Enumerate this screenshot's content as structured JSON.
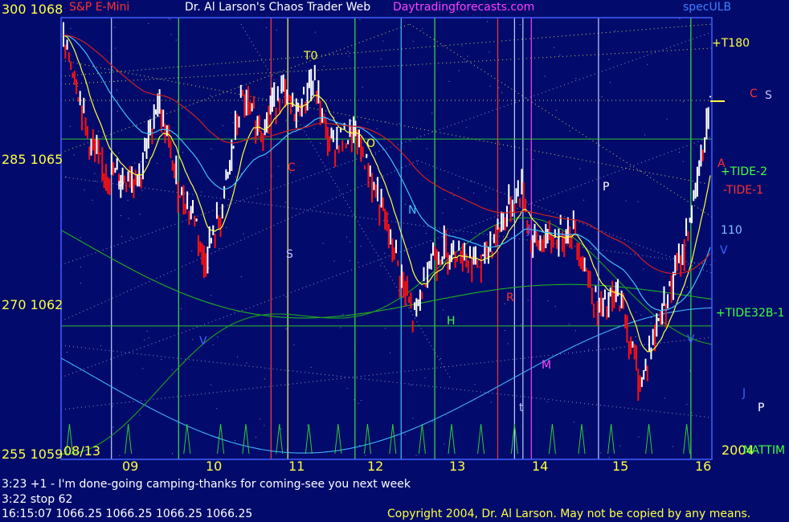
{
  "header": {
    "instrument": "S&P E-Mini",
    "title": "Dr. Al Larson's Chaos Trader Web",
    "site": "Daytradingforecasts.com",
    "spec": "specULB"
  },
  "colors": {
    "background": "#020b6b",
    "price_up": "#ffffff",
    "price_down": "#ff1010",
    "axis_label": "#ffff40",
    "ema_fast": "#ffff40",
    "ema_mid": "#40c0ff",
    "ema_slow": "#d02020",
    "tide_green": "#20c020"
  },
  "status": {
    "line1": "3:23 +1 - I'm done-going camping-thanks for coming-see you next week",
    "line2": "3:22 stop 62",
    "line3": "16:15:07   1066.25  1066.25  1066.25  1066.25",
    "copyright": "Copyright 2004, Dr. Al Larson. May not be copied by any means."
  },
  "right_labels": {
    "t180": "+T180",
    "c": "C",
    "s": "S",
    "tide2": "+TIDE-2",
    "tide1": "-TIDE-1",
    "v110": "110",
    "v": "V",
    "tide32": "+TIDE32B-1",
    "j": "J",
    "p": "P",
    "year": "2004",
    "nattim": "NATTIM"
  },
  "marker_labels": {
    "t0": "T0",
    "p1": "P",
    "c1": "C",
    "o1": "O",
    "n1": "N",
    "s1": "S",
    "h1": "H",
    "r1": "R",
    "m1": "M",
    "p2": "P",
    "j1": "J",
    "a1": "A",
    "v1": "V",
    "t1": "t",
    "v2": "V"
  },
  "chart_data": {
    "type": "candlestick",
    "date_label": "08/13",
    "x_axis": {
      "range": [
        8.4,
        16.15
      ],
      "ticks": [
        "09",
        "10",
        "11",
        "12",
        "13",
        "14",
        "15",
        "16"
      ]
    },
    "y_axis": {
      "range": [
        1059,
        1068
      ],
      "ticks": [
        {
          "label": "300  1068",
          "value": 1068
        },
        {
          "label": "285  1065",
          "value": 1065
        },
        {
          "label": "270  1062",
          "value": 1062
        },
        {
          "label": "255  1059",
          "value": 1059
        }
      ]
    },
    "price_keypoints": [
      [
        8.4,
        1067.5
      ],
      [
        8.55,
        1066.8
      ],
      [
        8.75,
        1065.3
      ],
      [
        8.9,
        1064.8
      ],
      [
        9.1,
        1064.6
      ],
      [
        9.35,
        1064.7
      ],
      [
        9.55,
        1066.2
      ],
      [
        9.8,
        1064.4
      ],
      [
        10.0,
        1063.8
      ],
      [
        10.1,
        1062.9
      ],
      [
        10.3,
        1063.8
      ],
      [
        10.55,
        1066.2
      ],
      [
        10.8,
        1065.6
      ],
      [
        11.0,
        1066.4
      ],
      [
        11.2,
        1065.9
      ],
      [
        11.4,
        1066.6
      ],
      [
        11.6,
        1065.3
      ],
      [
        11.9,
        1065.5
      ],
      [
        12.1,
        1064.6
      ],
      [
        12.35,
        1063.2
      ],
      [
        12.6,
        1061.7
      ],
      [
        12.8,
        1063.0
      ],
      [
        13.1,
        1063.2
      ],
      [
        13.4,
        1062.8
      ],
      [
        13.7,
        1063.9
      ],
      [
        13.9,
        1064.4
      ],
      [
        14.0,
        1063.3
      ],
      [
        14.2,
        1063.3
      ],
      [
        14.5,
        1063.6
      ],
      [
        14.8,
        1061.9
      ],
      [
        15.05,
        1062.2
      ],
      [
        15.3,
        1060.4
      ],
      [
        15.55,
        1061.9
      ],
      [
        15.8,
        1063.0
      ],
      [
        16.0,
        1064.7
      ],
      [
        16.15,
        1066.3
      ]
    ],
    "horizontal_levels": [
      1065.4,
      1061.6
    ],
    "vertical_lines": [
      {
        "x": 9.0,
        "color": "#c0d0ff"
      },
      {
        "x": 9.8,
        "color": "#40e040"
      },
      {
        "x": 10.9,
        "color": "#ff4040"
      },
      {
        "x": 11.1,
        "color": "#ffff60"
      },
      {
        "x": 11.9,
        "color": "#40e040"
      },
      {
        "x": 12.45,
        "color": "#40c0ff"
      },
      {
        "x": 12.85,
        "color": "#40e040"
      },
      {
        "x": 13.6,
        "color": "#ff3030"
      },
      {
        "x": 13.8,
        "color": "#c0d0ff"
      },
      {
        "x": 13.9,
        "color": "#c0d0ff"
      },
      {
        "x": 14.0,
        "color": "#ff40ff"
      },
      {
        "x": 14.8,
        "color": "#c0d0ff"
      },
      {
        "x": 15.9,
        "color": "#40e040"
      }
    ],
    "tide_spikes_x": [
      8.5,
      9.2,
      9.9,
      10.3,
      10.6,
      11.0,
      11.35,
      11.7,
      12.05,
      12.35,
      12.7,
      13.05,
      13.4,
      13.8,
      14.25,
      14.6,
      14.95,
      15.4,
      15.85
    ]
  }
}
